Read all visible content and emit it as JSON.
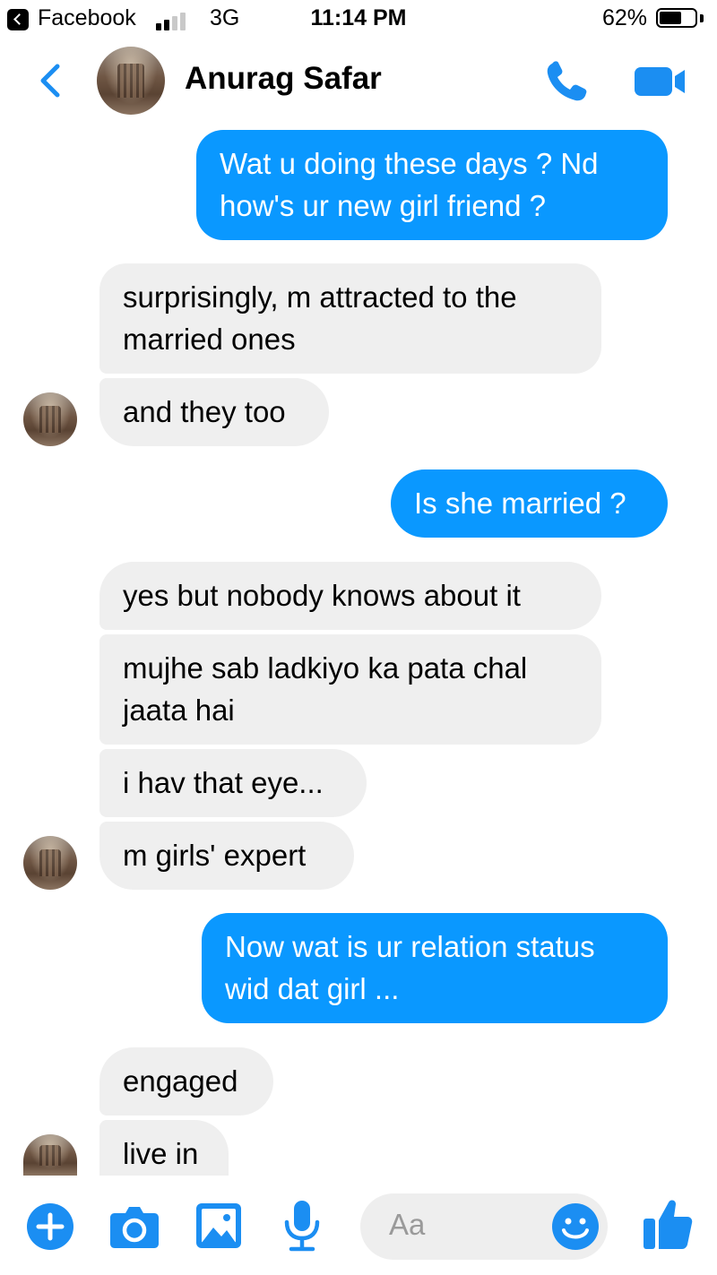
{
  "status_bar": {
    "back_app": "Facebook",
    "network": "3G",
    "time": "11:14 PM",
    "battery_percent": "62%",
    "battery_level": 0.62,
    "signal_bars": 2
  },
  "header": {
    "contact_name": "Anurag Safar"
  },
  "messages": [
    {
      "side": "out",
      "lines": [
        "Wat u doing these days ? Nd",
        "how's ur new girl friend ?"
      ]
    },
    {
      "side": "in",
      "lines": [
        "surprisingly, m attracted to the",
        "married ones"
      ]
    },
    {
      "side": "in",
      "lines": [
        "and they too"
      ]
    },
    {
      "side": "out",
      "lines": [
        "Is she married ?"
      ]
    },
    {
      "side": "in",
      "lines": [
        "yes  but nobody knows about it"
      ]
    },
    {
      "side": "in",
      "lines": [
        "mujhe sab ladkiyo ka pata chal",
        "jaata hai"
      ]
    },
    {
      "side": "in",
      "lines": [
        "i hav that eye..."
      ]
    },
    {
      "side": "in",
      "lines": [
        "m girls' expert"
      ]
    },
    {
      "side": "out",
      "lines": [
        "Now wat is ur relation status",
        "wid dat girl ..."
      ]
    },
    {
      "side": "in",
      "lines": [
        "engaged"
      ]
    },
    {
      "side": "in",
      "lines": [
        "live in"
      ]
    }
  ],
  "composer": {
    "placeholder": "Aa"
  },
  "colors": {
    "accent": "#0a98ff",
    "incoming_bubble": "#efefef",
    "icon_blue": "#1b8ef2"
  }
}
